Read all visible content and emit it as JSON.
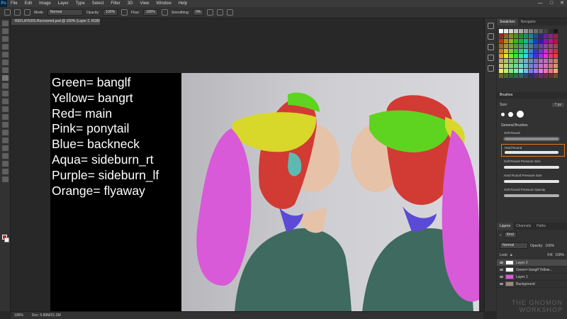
{
  "app": {
    "logo": "Ps"
  },
  "menu": [
    "File",
    "Edit",
    "Image",
    "Layer",
    "Type",
    "Select",
    "Filter",
    "3D",
    "View",
    "Window",
    "Help"
  ],
  "window_controls": [
    "—",
    "□",
    "✕"
  ],
  "options": {
    "mode_label": "Mode:",
    "mode_value": "Normal",
    "opacity_label": "Opacity:",
    "opacity_value": "100%",
    "flow_label": "Flow:",
    "flow_value": "100%",
    "smoothing_label": "Smoothing:",
    "smoothing_value": "0%"
  },
  "document": {
    "tab_title": "REFLAYERS-Recovered.psd @ 100% (Layer 2, RGB/8#) *"
  },
  "legend": [
    "Green= banglf",
    "Yellow= bangrt",
    "Red= main",
    "Pink= ponytail",
    "Blue= backneck",
    "Aqua= sideburn_rt",
    "Purple= sideburn_lf",
    "Orange= flyaway"
  ],
  "colors": {
    "green": "#5fd420",
    "yellow": "#d8d82a",
    "red": "#d23a34",
    "pink": "#d85ad8",
    "blue": "#5a4ad6",
    "aqua": "#4ad0c8",
    "skin": "#e6c2a8",
    "sweater": "#3f6a5f",
    "fg_color": "#d81e1e",
    "bg_color": "#ffffff",
    "brush_selected_border": "#e07a1f"
  },
  "statusbar": {
    "zoom": "100%",
    "doc": "Doc: 5.89M/21.2M"
  },
  "swatches_panel": {
    "tabs": [
      "Swatches",
      "Navigator"
    ]
  },
  "brushes_panel": {
    "title": "Brushes",
    "size_label": "Size:",
    "size_value": "7 px",
    "group": "General Brushes",
    "items": [
      "Soft Round",
      "Hard Round",
      "Soft Round Pressure Size",
      "Hard Round Pressure Size",
      "Soft Round Pressure Opacity"
    ]
  },
  "layers_panel": {
    "tabs": [
      "Layers",
      "Channels",
      "Paths"
    ],
    "kind": "Kind",
    "blend_mode": "Normal",
    "opacity_label": "Opacity:",
    "opacity_value": "100%",
    "lock_label": "Lock:",
    "fill_label": "Fill:",
    "fill_value": "100%",
    "layers": [
      "Layer 2",
      "Green= banglf Yellow...",
      "Layer 1",
      "Background"
    ]
  },
  "watermark": {
    "line1": "THE GNOMON",
    "line2": "WORKSHOP"
  }
}
